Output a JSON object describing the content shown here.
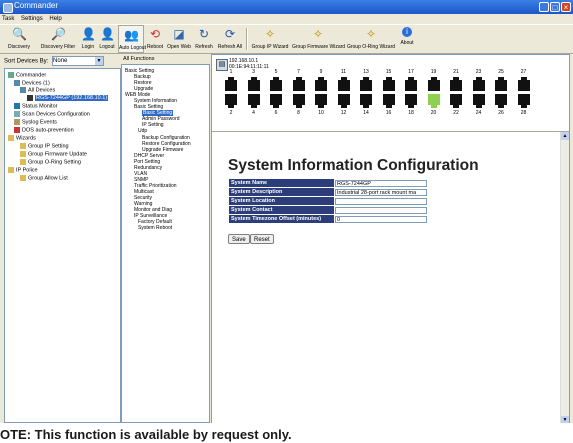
{
  "window": {
    "title": "Commander"
  },
  "menu": [
    "Task",
    "Settings",
    "Help"
  ],
  "toolbar": [
    {
      "label": "Discovery",
      "icon": "magnifier-icon"
    },
    {
      "label": "Discovery Filter",
      "icon": "filter-magnifier-icon"
    },
    {
      "label": "Login",
      "icon": "user-icon"
    },
    {
      "label": "Logout",
      "icon": "user-out-icon"
    },
    {
      "label": "Auto Logout",
      "icon": "user-clock-icon"
    },
    {
      "label": "Reboot",
      "icon": "reboot-icon"
    },
    {
      "label": "Open Web",
      "icon": "web-icon"
    },
    {
      "label": "Refresh",
      "icon": "refresh-icon"
    },
    {
      "label": "Refresh All",
      "icon": "refresh-all-icon"
    },
    {
      "label": "Group IP Wizard",
      "icon": "wand-icon"
    },
    {
      "label": "Group Firmware Wizard",
      "icon": "wand-icon"
    },
    {
      "label": "Group O-Ring Wizard",
      "icon": "wand-icon"
    },
    {
      "label": "About",
      "icon": "info-icon"
    }
  ],
  "left": {
    "sort_label": "Sort Devices By:",
    "sort_value": "None",
    "tree": [
      "Commander",
      "Devices (1)",
      "All Devices",
      "RGS-7244GP (192.168.10.1)",
      "Status Monitor",
      "Scan Devices Configuration",
      "Syslog Events",
      "DOS auto-prevention",
      "Wizards",
      "Group IP Setting",
      "Group Firmware Update",
      "Group O-Ring Setting",
      "IP Police",
      "Group Allow List"
    ]
  },
  "functions": {
    "title": "All Functions",
    "items": [
      "Basic Setting",
      "Backup",
      "Restore",
      "Upgrade",
      "WEB Mode",
      "System Information",
      "Basic Setting",
      "Basic Setting",
      "Admin Password",
      "IP Setting",
      "Udp",
      "Backup Configuration",
      "Restore Configuration",
      "Upgrade Firmware",
      "DHCP Server",
      "Port Setting",
      "Redundancy",
      "VLAN",
      "SNMP",
      "Traffic Prioritization",
      "Multicast",
      "Security",
      "Warning",
      "Monitor and Diag",
      "IP Surveillance",
      "Factory Default",
      "System Reboot"
    ]
  },
  "device": {
    "ip": "192.168.10.1",
    "mac": "00:1E:94:11:11:11",
    "odd_ports": [
      "1",
      "3",
      "5",
      "7",
      "9",
      "11",
      "13",
      "15",
      "17",
      "19",
      "21",
      "23",
      "25",
      "27"
    ],
    "even_ports": [
      "2",
      "4",
      "6",
      "8",
      "10",
      "12",
      "14",
      "16",
      "18",
      "20",
      "22",
      "24",
      "26",
      "28"
    ],
    "link_port": "20"
  },
  "page": {
    "title": "System Information Configuration",
    "fields": [
      {
        "label": "System Name",
        "value": "RGS-7244GP"
      },
      {
        "label": "System Description",
        "value": "Industrial 28-port rack mount ma"
      },
      {
        "label": "System Location",
        "value": ""
      },
      {
        "label": "System Contact",
        "value": ""
      },
      {
        "label": "System Timezone Offset (minutes)",
        "value": "0"
      }
    ],
    "save": "Save",
    "reset": "Reset"
  },
  "note": "OTE: This function is available by request only.",
  "colors": {
    "title_bar": "#1c56c8",
    "label_cell": "#2c3e7a",
    "link_port": "#8fd14f"
  }
}
